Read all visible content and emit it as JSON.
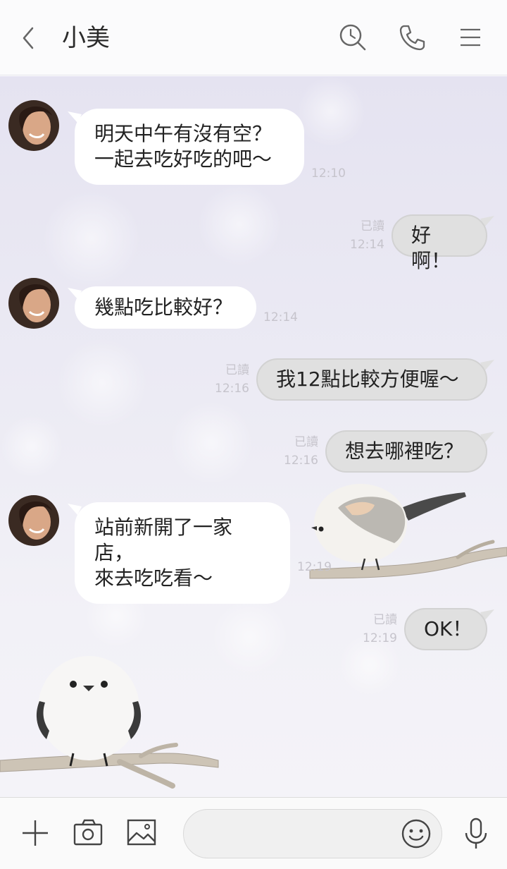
{
  "header": {
    "title": "小美",
    "back_icon": "chevron-left-icon",
    "search_icon": "search-icon",
    "call_icon": "phone-icon",
    "menu_icon": "menu-icon"
  },
  "messages": [
    {
      "side": "in",
      "text": "明天中午有沒有空？\n一起去吃好吃的吧～",
      "time": "12:10"
    },
    {
      "side": "out",
      "text": "好啊！",
      "read": "已讀",
      "time": "12:14"
    },
    {
      "side": "in",
      "text": "幾點吃比較好？",
      "time": "12:14"
    },
    {
      "side": "out",
      "text": "我12點比較方便喔～",
      "read": "已讀",
      "time": "12:16"
    },
    {
      "side": "out",
      "text": "想去哪裡吃？",
      "read": "已讀",
      "time": "12:16"
    },
    {
      "side": "in",
      "text": "站前新開了一家店，\n來去吃吃看～",
      "time": "12:19"
    },
    {
      "side": "out",
      "text": "OK！",
      "read": "已讀",
      "time": "12:19"
    }
  ],
  "input": {
    "placeholder": "",
    "icons": [
      "plus-icon",
      "camera-icon",
      "image-icon",
      "emoji-icon",
      "mic-icon"
    ]
  },
  "colors": {
    "header_bg": "#fbfbfc",
    "chat_bg": "#e8e7f2",
    "bubble_in": "#ffffff",
    "bubble_out": "#e0e0e0"
  }
}
